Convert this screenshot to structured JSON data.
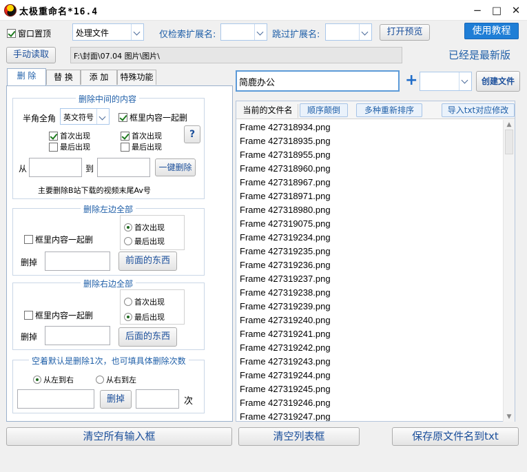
{
  "window": {
    "title": "太极重命名*16.4",
    "minimize": "−",
    "maximize": "□",
    "close": "✕"
  },
  "toolbar": {
    "topmost_label": "窗口置顶",
    "mode_value": "处理文件",
    "search_ext_label": "仅检索扩展名:",
    "search_ext_value": "",
    "skip_ext_label": "跳过扩展名:",
    "skip_ext_value": "",
    "preview_button": "打开预览",
    "tutorial_button": "使用教程",
    "manual_read_button": "手动读取",
    "path_value": "F:\\封面\\07.04 图片\\图片\\",
    "version_status": "已经是最新版"
  },
  "tabs": [
    {
      "label": "删 除",
      "active": true
    },
    {
      "label": "替 换",
      "active": false
    },
    {
      "label": "添 加",
      "active": false
    },
    {
      "label": "特殊功能",
      "active": false
    }
  ],
  "delete_middle": {
    "title": "删除中间的内容",
    "width_label": "半角全角",
    "width_value": "英文符号",
    "include_box_label": "框里内容一起删",
    "left_first": "首次出现",
    "left_last": "最后出现",
    "right_first": "首次出现",
    "right_last": "最后出现",
    "help": "?",
    "from_label": "从",
    "to_label": "到",
    "from_value": "",
    "to_value": "",
    "one_click_button": "一键删除",
    "hint": "主要删除B站下载的视频末尾Av号"
  },
  "delete_left": {
    "title": "删除左边全部",
    "include_box_label": "框里内容一起删",
    "first": "首次出现",
    "last": "最后出现",
    "remove_label": "删掉",
    "remove_value": "",
    "action_button": "前面的东西"
  },
  "delete_right": {
    "title": "删除右边全部",
    "include_box_label": "框里内容一起删",
    "first": "首次出现",
    "last": "最后出现",
    "remove_label": "删掉",
    "remove_value": "",
    "action_button": "后面的东西"
  },
  "delete_count": {
    "title": "空着默认是删除1次，也可填具体删除次数",
    "left_to_right": "从左到右",
    "right_to_left": "从右到左",
    "text_value": "",
    "delete_button": "删掉",
    "count_value": "",
    "count_label": "次"
  },
  "right_panel": {
    "name_value": "简鹿办公",
    "plus": "+",
    "suffix_value": "",
    "create_button": "创建文件"
  },
  "list": {
    "current_names_header": "当前的文件名",
    "reverse_button": "顺序颠倒",
    "resort_button": "多种重新排序",
    "import_txt_button": "导入txt对应修改",
    "items": [
      "Frame 427318934.png",
      "Frame 427318935.png",
      "Frame 427318955.png",
      "Frame 427318960.png",
      "Frame 427318967.png",
      "Frame 427318971.png",
      "Frame 427318980.png",
      "Frame 427319075.png",
      "Frame 427319234.png",
      "Frame 427319235.png",
      "Frame 427319236.png",
      "Frame 427319237.png",
      "Frame 427319238.png",
      "Frame 427319239.png",
      "Frame 427319240.png",
      "Frame 427319241.png",
      "Frame 427319242.png",
      "Frame 427319243.png",
      "Frame 427319244.png",
      "Frame 427319245.png",
      "Frame 427319246.png",
      "Frame 427319247.png"
    ]
  },
  "bottom": {
    "clear_inputs_button": "清空所有输入框",
    "clear_list_button": "清空列表框",
    "save_names_button": "保存原文件名到txt"
  },
  "colors": {
    "accent": "#1f7ed6",
    "link_text": "#1f5fa8"
  }
}
